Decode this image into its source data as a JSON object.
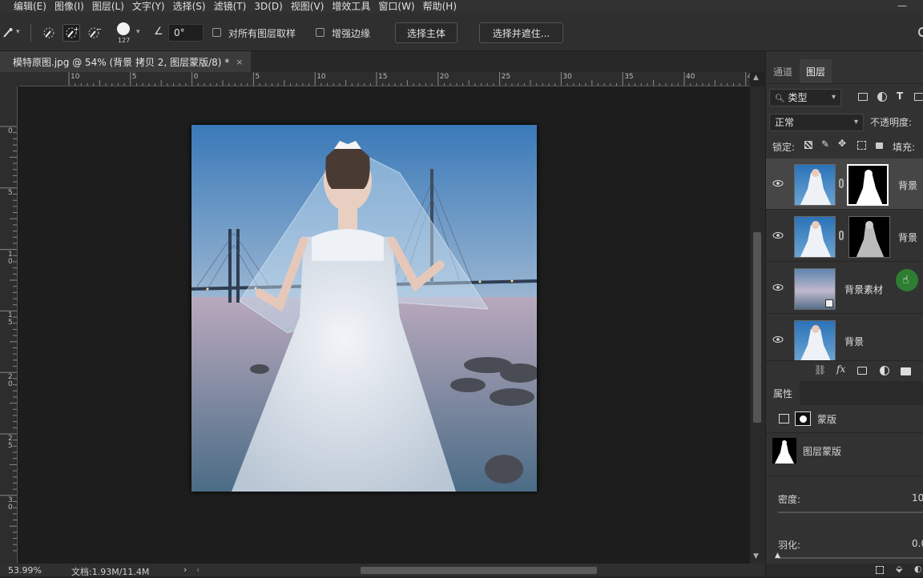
{
  "menu": [
    "编辑(E)",
    "图像(I)",
    "图层(L)",
    "文字(Y)",
    "选择(S)",
    "滤镜(T)",
    "3D(D)",
    "视图(V)",
    "增效工具",
    "窗口(W)",
    "帮助(H)"
  ],
  "options": {
    "brush_size": "127",
    "angle_value": "0°",
    "sample_all_layers": "对所有图层取样",
    "enhance_edge": "增强边缘",
    "select_subject": "选择主体",
    "select_and_mask": "选择并遮住..."
  },
  "document": {
    "tab_title": "模特原图.jpg @ 54% (背景 拷贝 2, 图层蒙版/8) *",
    "close": "×",
    "ruler_h": [
      "10",
      "5",
      "0",
      "5",
      "10",
      "15",
      "20",
      "25",
      "30",
      "35",
      "40",
      "45"
    ],
    "ruler_v": [
      "0",
      "5",
      "1\n0",
      "1\n5",
      "2\n0",
      "2\n5",
      "3\n0"
    ]
  },
  "status": {
    "zoom": "53.99%",
    "doc": "文档:1.93M/11.4M",
    "arrow": "›",
    "left_arrow": "‹"
  },
  "panel": {
    "tabs": [
      "通道",
      "图层"
    ],
    "filter_type": "类型",
    "blend_mode": "正常",
    "opacity_label": "不透明度:",
    "lock_label": "锁定:",
    "fill_label": "填充:",
    "layers": [
      {
        "name": "背景",
        "selected": true,
        "has_mask": true
      },
      {
        "name": "背景",
        "selected": false,
        "has_mask": true
      },
      {
        "name": "背景素材",
        "selected": false,
        "has_mask": false
      },
      {
        "name": "背景",
        "selected": false,
        "has_mask": false
      }
    ],
    "properties_tab": "属性",
    "mask_label": "蒙版",
    "layer_mask_label": "图层蒙版",
    "density_label": "密度:",
    "density_value": "10",
    "feather_label": "羽化:",
    "feather_value": "0.0"
  },
  "colors": {
    "bg": "#232323",
    "panel": "#323232",
    "canvas": "#1c1d1c",
    "selected_layer": "#464646",
    "cursor_green": "#2e7d32"
  },
  "icons": [
    "eye-icon",
    "search-icon",
    "link-icon",
    "fx-icon",
    "mask-icon",
    "adjustment-icon",
    "folder-icon",
    "brush-icon",
    "hand-cursor-icon"
  ]
}
